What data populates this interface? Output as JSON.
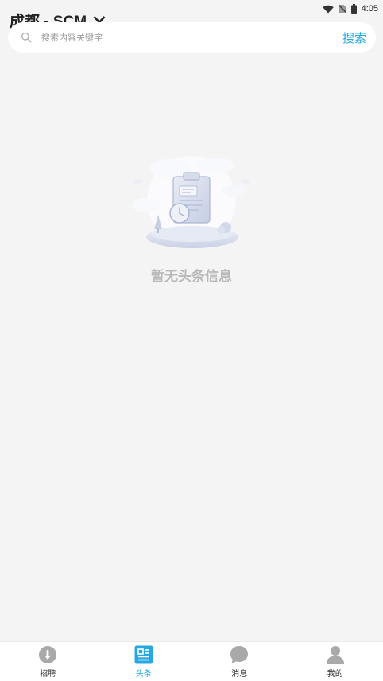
{
  "status_bar": {
    "time": "4:05",
    "icons": [
      "wifi-icon",
      "no-sim-icon",
      "battery-icon"
    ]
  },
  "header": {
    "city": "成都 - SCM"
  },
  "search": {
    "placeholder": "搜索内容关键字",
    "value": "",
    "button_label": "搜索"
  },
  "empty_state": {
    "message": "暂无头条信息"
  },
  "colors": {
    "accent": "#27a8e0",
    "background": "#f4f4f4",
    "inactive_icon": "#a9a9a9"
  },
  "bottom_nav": {
    "active_index": 1,
    "items": [
      {
        "label": "招聘",
        "icon": "recruit-icon"
      },
      {
        "label": "头条",
        "icon": "headlines-icon"
      },
      {
        "label": "消息",
        "icon": "message-icon"
      },
      {
        "label": "我的",
        "icon": "profile-icon"
      }
    ]
  }
}
